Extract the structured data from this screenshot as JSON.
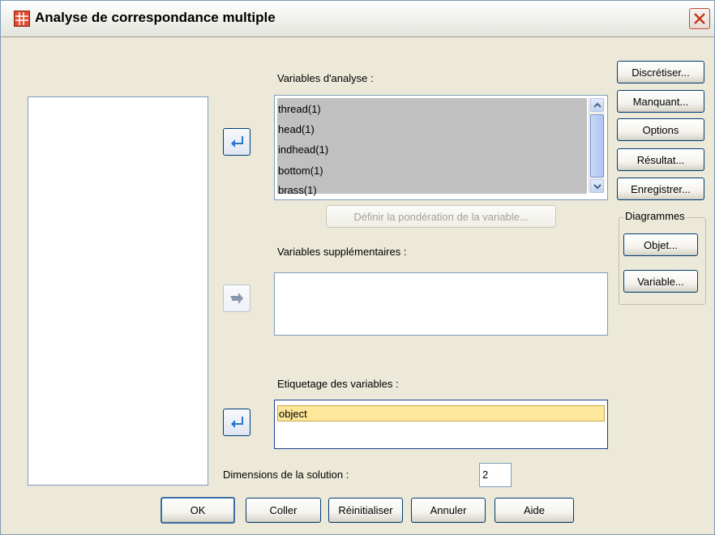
{
  "window": {
    "title": "Analyse de correspondance multiple",
    "close_label": "Fermer"
  },
  "source_list": {
    "items": []
  },
  "analysis": {
    "label": "Variables d'analyse :",
    "items": [
      "thread(1)",
      "head(1)",
      "indhead(1)",
      "bottom(1)",
      "brass(1)"
    ],
    "weight_button": "Définir la pondération de la variable..."
  },
  "supplementary": {
    "label": "Variables supplémentaires :",
    "items": []
  },
  "labeling": {
    "label": "Etiquetage des variables :",
    "items": [
      "object"
    ]
  },
  "dimensions": {
    "label": "Dimensions de la solution :",
    "value": "2"
  },
  "side_buttons": {
    "discretize": "Discrétiser...",
    "missing": "Manquant...",
    "options": "Options",
    "output": "Résultat...",
    "save": "Enregistrer..."
  },
  "plots": {
    "legend": "Diagrammes",
    "object": "Objet...",
    "variable": "Variable..."
  },
  "bottom_buttons": {
    "ok": "OK",
    "paste": "Coller",
    "reset": "Réinitialiser",
    "cancel": "Annuler",
    "help": "Aide"
  },
  "colors": {
    "dialog_bg": "#ece9d8",
    "selection_gray": "#c0c0c0",
    "highlight_yellow": "#fde79a",
    "button_border": "#003c74",
    "arrow_blue": "#2c74c8"
  },
  "icons": {
    "window": "spss-table-icon",
    "close": "close-icon",
    "move_right": "arrow-bent-right-icon",
    "move_left": "arrow-bent-left-icon"
  }
}
